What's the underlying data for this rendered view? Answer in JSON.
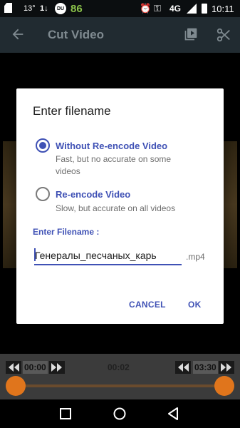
{
  "status_bar": {
    "temperature": "13°",
    "signal_left": "1↓",
    "shield_badge": "DU",
    "battery_level": "86",
    "network": "4G",
    "time": "10:11"
  },
  "app_bar": {
    "title": "Cut Video",
    "icons": [
      "arrow-back-icon",
      "video-library-icon",
      "scissors-icon"
    ]
  },
  "timeline": {
    "start_time": "00:00",
    "current_time": "00:02",
    "end_time": "03:30",
    "accent_color": "#e0751c"
  },
  "dialog": {
    "title": "Enter filename",
    "options": [
      {
        "label": "Without Re-encode Video",
        "description": "Fast, but no accurate on some videos",
        "selected": true
      },
      {
        "label": "Re-encode Video",
        "description": "Slow, but accurate on all videos",
        "selected": false
      }
    ],
    "filename_label": "Enter Filename :",
    "filename_value": "Генералы_песчаных_карь",
    "extension": ".mp4",
    "cancel_label": "CANCEL",
    "ok_label": "OK",
    "accent_color": "#3f51b5"
  }
}
